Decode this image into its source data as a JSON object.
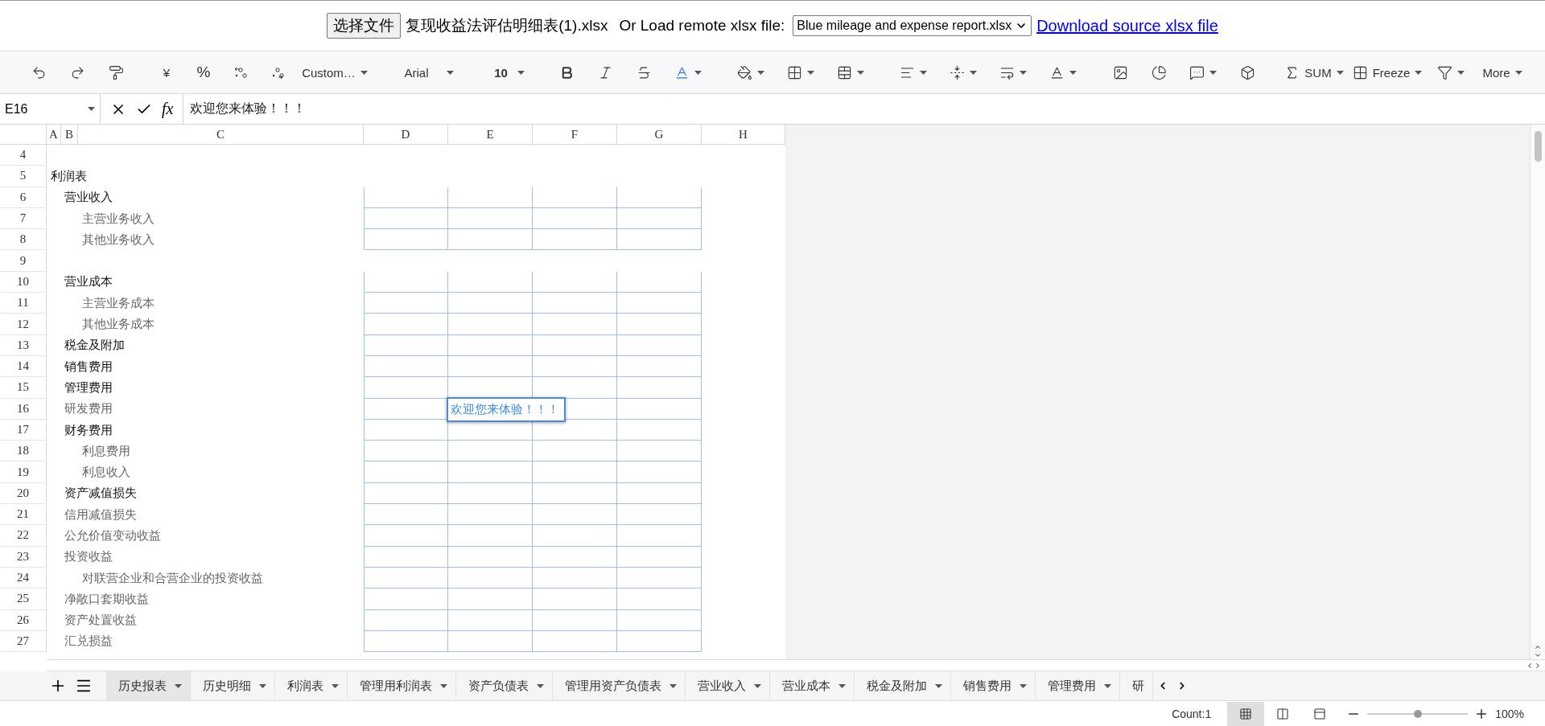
{
  "file_bar": {
    "choose_button": "选择文件",
    "file_name": "复现收益法评估明细表(1).xlsx",
    "remote_label": "Or Load remote xlsx file:",
    "remote_select": "Blue mileage and expense report.xlsx",
    "download_link": "Download source xlsx file"
  },
  "toolbar": {
    "currency": "¥",
    "percent": "%",
    "number_format": "Custom…",
    "font": "Arial",
    "font_size": "10",
    "sum": "SUM",
    "freeze": "Freeze",
    "more": "More"
  },
  "formula_bar": {
    "cell_ref": "E16",
    "fx": "fx",
    "value": "欢迎您来体验！！！"
  },
  "columns": [
    "A",
    "B",
    "C",
    "D",
    "E",
    "F",
    "G",
    "H"
  ],
  "rows": [
    {
      "number": "4",
      "bordered": false
    },
    {
      "number": "5",
      "label": "利润表",
      "kind": "title",
      "bordered": false
    },
    {
      "number": "6",
      "label": "营业收入",
      "kind": "main",
      "bordered": true
    },
    {
      "number": "7",
      "label": "主营业务收入",
      "kind": "sub",
      "bordered": true
    },
    {
      "number": "8",
      "label": "其他业务收入",
      "kind": "sub",
      "bordered": true
    },
    {
      "number": "9",
      "bordered": false
    },
    {
      "number": "10",
      "label": "营业成本",
      "kind": "main",
      "bordered": true
    },
    {
      "number": "11",
      "label": "主营业务成本",
      "kind": "sub",
      "bordered": true
    },
    {
      "number": "12",
      "label": "其他业务成本",
      "kind": "sub",
      "bordered": true
    },
    {
      "number": "13",
      "label": "税金及附加",
      "kind": "main",
      "bordered": true
    },
    {
      "number": "14",
      "label": "销售费用",
      "kind": "main",
      "bordered": true
    },
    {
      "number": "15",
      "label": "管理费用",
      "kind": "main",
      "bordered": true
    },
    {
      "number": "16",
      "label": "研发费用",
      "kind": "plain",
      "bordered": true,
      "column_e": {
        "value": "欢迎您来体验！！！",
        "selected": true
      }
    },
    {
      "number": "17",
      "label": "财务费用",
      "kind": "main",
      "bordered": true
    },
    {
      "number": "18",
      "label": "利息费用",
      "kind": "sub",
      "bordered": true
    },
    {
      "number": "19",
      "label": "利息收入",
      "kind": "sub",
      "bordered": true
    },
    {
      "number": "20",
      "label": "资产减值损失",
      "kind": "main",
      "bordered": true
    },
    {
      "number": "21",
      "label": "信用减值损失",
      "kind": "plain",
      "bordered": true
    },
    {
      "number": "22",
      "label": "公允价值变动收益",
      "kind": "plain",
      "bordered": true
    },
    {
      "number": "23",
      "label": "投资收益",
      "kind": "plain",
      "bordered": true
    },
    {
      "number": "24",
      "label": "对联营企业和合营企业的投资收益",
      "kind": "sub",
      "bordered": true
    },
    {
      "number": "25",
      "label": "净敞口套期收益",
      "kind": "plain",
      "bordered": true
    },
    {
      "number": "26",
      "label": "资产处置收益",
      "kind": "plain",
      "bordered": true
    },
    {
      "number": "27",
      "label": "汇兑损益",
      "kind": "plain",
      "bordered": true
    }
  ],
  "sheet_tabs": [
    {
      "label": "历史报表",
      "selected": true
    },
    {
      "label": "历史明细",
      "selected": false
    },
    {
      "label": "利润表",
      "selected": false
    },
    {
      "label": "管理用利润表",
      "selected": false
    },
    {
      "label": "资产负债表",
      "selected": false
    },
    {
      "label": "管理用资产负债表",
      "selected": false
    },
    {
      "label": "营业收入",
      "selected": false
    },
    {
      "label": "营业成本",
      "selected": false
    },
    {
      "label": "税金及附加",
      "selected": false
    },
    {
      "label": "销售费用",
      "selected": false
    },
    {
      "label": "管理费用",
      "selected": false
    },
    {
      "label": "研",
      "selected": false
    }
  ],
  "status_bar": {
    "count": "Count:1",
    "view_buttons": [
      {
        "selected": true
      },
      {
        "selected": false
      },
      {
        "selected": false
      }
    ],
    "zoom": {
      "level": 0.5
    },
    "zoom_reading": "100%"
  }
}
